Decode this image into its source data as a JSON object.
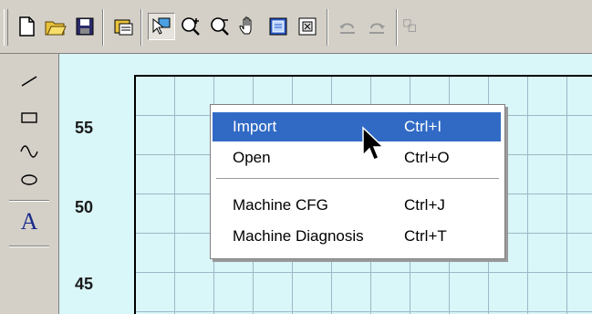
{
  "toolbar": {
    "buttons": [
      {
        "name": "new-icon"
      },
      {
        "name": "open-folder-icon"
      },
      {
        "name": "save-icon"
      },
      {
        "name": "properties-icon"
      },
      {
        "name": "select-pointer-icon"
      },
      {
        "name": "zoom-in-icon"
      },
      {
        "name": "zoom-out-icon"
      },
      {
        "name": "pan-hand-icon"
      },
      {
        "name": "fit-page-icon"
      },
      {
        "name": "zoom-extents-icon"
      },
      {
        "name": "undo-icon"
      },
      {
        "name": "redo-icon"
      }
    ]
  },
  "palette": {
    "tools": [
      {
        "name": "line-tool-icon"
      },
      {
        "name": "rectangle-tool-icon"
      },
      {
        "name": "curve-tool-icon"
      },
      {
        "name": "ellipse-tool-icon"
      },
      {
        "name": "text-tool-icon",
        "glyph": "A"
      }
    ]
  },
  "canvas": {
    "y_ticks": [
      "55",
      "50",
      "45"
    ]
  },
  "context_menu": {
    "items": [
      {
        "label": "Import",
        "shortcut": "Ctrl+I",
        "highlighted": true
      },
      {
        "label": "Open",
        "shortcut": "Ctrl+O"
      },
      {
        "label": "Machine CFG",
        "shortcut": "Ctrl+J"
      },
      {
        "label": "Machine Diagnosis",
        "shortcut": "Ctrl+T"
      }
    ]
  },
  "colors": {
    "menu_highlight": "#316ac5",
    "canvas_bg": "#d9f6f8",
    "grid": "#9fb7c8"
  }
}
